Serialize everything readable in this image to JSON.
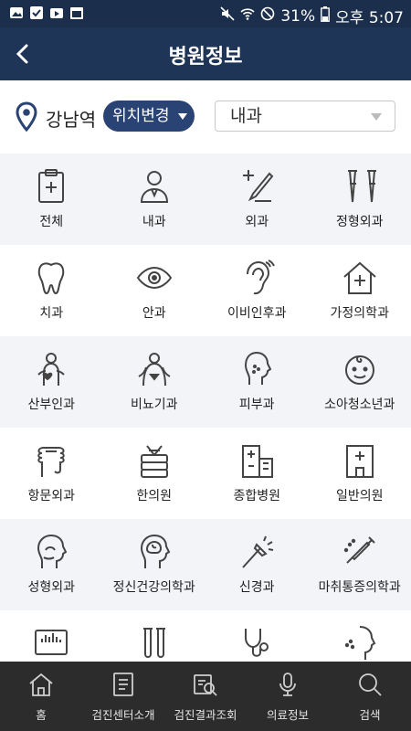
{
  "status_bar": {
    "battery": "31%",
    "time": "오후 5:07"
  },
  "header": {
    "title": "병원정보"
  },
  "location": {
    "name": "강남역",
    "change_label": "위치변경",
    "department_selected": "내과"
  },
  "departments": [
    {
      "label": "전체"
    },
    {
      "label": "내과"
    },
    {
      "label": "외과"
    },
    {
      "label": "정형외과"
    },
    {
      "label": "치과"
    },
    {
      "label": "안과"
    },
    {
      "label": "이비인후과"
    },
    {
      "label": "가정의학과"
    },
    {
      "label": "산부인과"
    },
    {
      "label": "비뇨기과"
    },
    {
      "label": "피부과"
    },
    {
      "label": "소아청소년과"
    },
    {
      "label": "항문외과"
    },
    {
      "label": "한의원"
    },
    {
      "label": "종합병원"
    },
    {
      "label": "일반의원"
    },
    {
      "label": "성형외과"
    },
    {
      "label": "정신건강의학과"
    },
    {
      "label": "신경과"
    },
    {
      "label": "마취통증의학과"
    }
  ],
  "bottom_nav": [
    {
      "label": "홈"
    },
    {
      "label": "검진센터소개"
    },
    {
      "label": "검진결과조회"
    },
    {
      "label": "의료정보"
    },
    {
      "label": "검색"
    }
  ],
  "colors": {
    "header": "#1f3557",
    "accent": "#2a4375",
    "tabbar": "#2c2c2c"
  }
}
